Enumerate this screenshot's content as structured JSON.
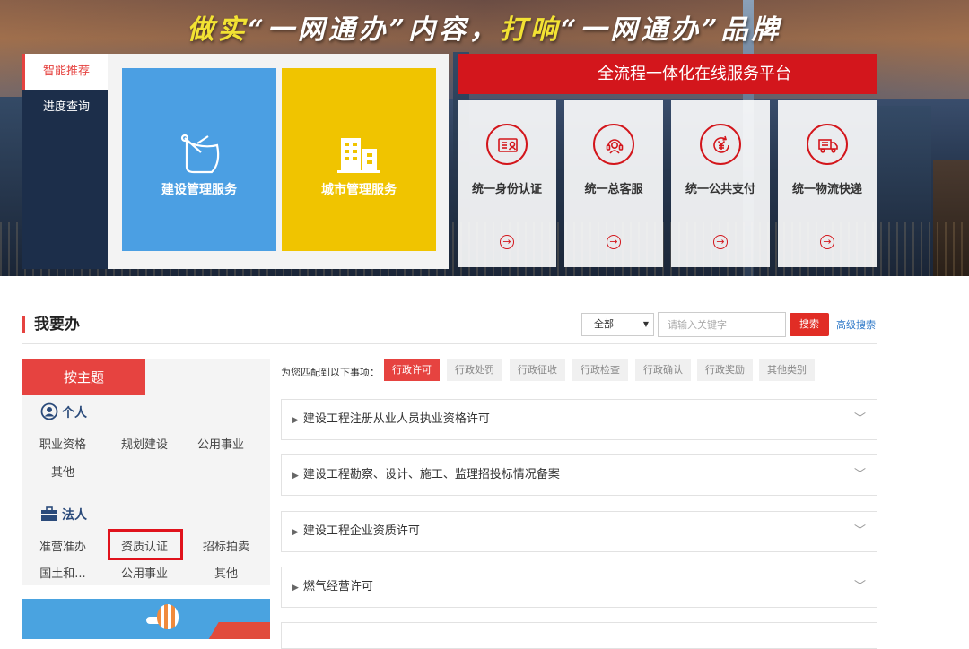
{
  "banner": {
    "slogan": {
      "p1": "做实",
      "p2": "“一网通办”内容，",
      "p3": "打响",
      "p4": "“一网通办”品牌"
    },
    "tabs": [
      "智能推荐",
      "进度查询"
    ],
    "tiles": [
      {
        "label": "建设管理服务",
        "color": "#4b9fe3",
        "icon": "satellite-dish-icon"
      },
      {
        "label": "城市管理服务",
        "color": "#f0c400",
        "icon": "building-icon"
      }
    ],
    "platform_title": "全流程一体化在线服务平台",
    "services": [
      {
        "label": "统一身份认证",
        "icon": "id-card-icon"
      },
      {
        "label": "统一总客服",
        "icon": "customer-service-icon"
      },
      {
        "label": "统一公共支付",
        "icon": "yuan-payment-icon"
      },
      {
        "label": "统一物流快递",
        "icon": "delivery-truck-icon"
      }
    ],
    "arrow_glyph": "→"
  },
  "section": {
    "title": "我要办",
    "select_value": "全部",
    "search_placeholder": "请输入关键字",
    "search_button": "搜索",
    "advanced_search": "高级搜索"
  },
  "theme": {
    "tab_label": "按主题",
    "personal": {
      "label": "个人",
      "items": [
        "职业资格",
        "规划建设",
        "公用事业",
        "其他"
      ]
    },
    "corporate": {
      "label": "法人",
      "items": [
        "准营准办",
        "资质认证",
        "招标拍卖",
        "国土和...",
        "公用事业",
        "其他"
      ]
    }
  },
  "matters": {
    "prompt": "为您匹配到以下事项：",
    "categories": [
      "行政许可",
      "行政处罚",
      "行政征收",
      "行政检查",
      "行政确认",
      "行政奖励",
      "其他类别"
    ],
    "items": [
      "建设工程注册从业人员执业资格许可",
      "建设工程勘察、设计、施工、监理招投标情况备案",
      "建设工程企业资质许可",
      "燃气经营许可"
    ]
  },
  "colors": {
    "accent_red": "#e64340",
    "platform_red": "#d3161c",
    "link_blue": "#2d78c8",
    "nav_dark": "#1c2e4a"
  }
}
